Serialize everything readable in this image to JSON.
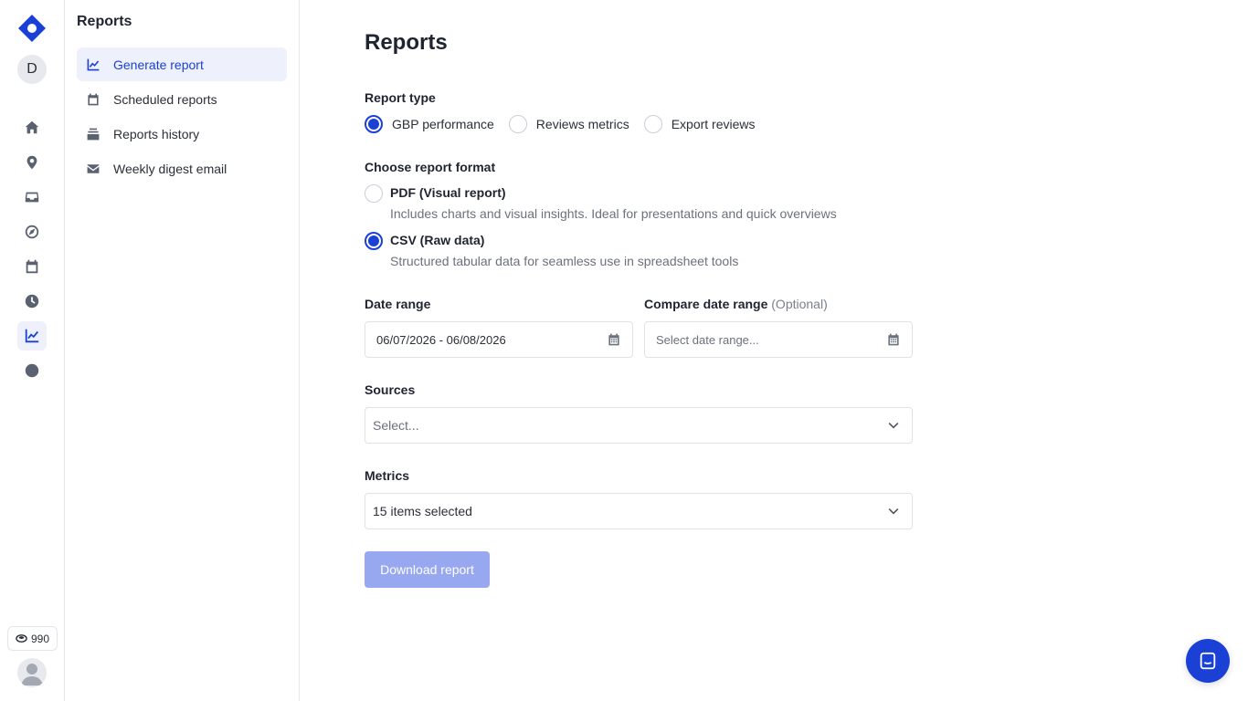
{
  "rail": {
    "avatar_initial": "D",
    "credits": "990",
    "items": [
      {
        "icon": "home-icon"
      },
      {
        "icon": "location-pin-icon"
      },
      {
        "icon": "inbox-icon"
      },
      {
        "icon": "compass-icon"
      },
      {
        "icon": "calendar-icon"
      },
      {
        "icon": "clock-icon"
      },
      {
        "icon": "chart-line-icon",
        "active": true
      },
      {
        "icon": "globe-icon"
      }
    ]
  },
  "sidebar": {
    "title": "Reports",
    "items": [
      {
        "label": "Generate report",
        "icon": "chart-line-icon",
        "active": true
      },
      {
        "label": "Scheduled reports",
        "icon": "calendar-icon"
      },
      {
        "label": "Reports history",
        "icon": "stack-icon"
      },
      {
        "label": "Weekly digest email",
        "icon": "envelope-icon"
      }
    ]
  },
  "main": {
    "title": "Reports",
    "report_type": {
      "label": "Report type",
      "options": [
        "GBP performance",
        "Reviews metrics",
        "Export reviews"
      ],
      "selected": "GBP performance"
    },
    "report_format": {
      "label": "Choose report format",
      "options": [
        {
          "title": "PDF (Visual report)",
          "description": "Includes charts and visual insights. Ideal for presentations and quick overviews"
        },
        {
          "title": "CSV (Raw data)",
          "description": "Structured tabular data for seamless use in spreadsheet tools"
        }
      ],
      "selected": "CSV (Raw data)"
    },
    "date_range": {
      "label": "Date range",
      "value": "06/07/2026 - 06/08/2026"
    },
    "compare_date_range": {
      "label": "Compare date range",
      "optional": "(Optional)",
      "placeholder": "Select date range..."
    },
    "sources": {
      "label": "Sources",
      "placeholder": "Select..."
    },
    "metrics": {
      "label": "Metrics",
      "value": "15 items selected"
    },
    "download_label": "Download report"
  },
  "colors": {
    "accent": "#1a40d6",
    "button_disabled": "#98a8f0"
  }
}
